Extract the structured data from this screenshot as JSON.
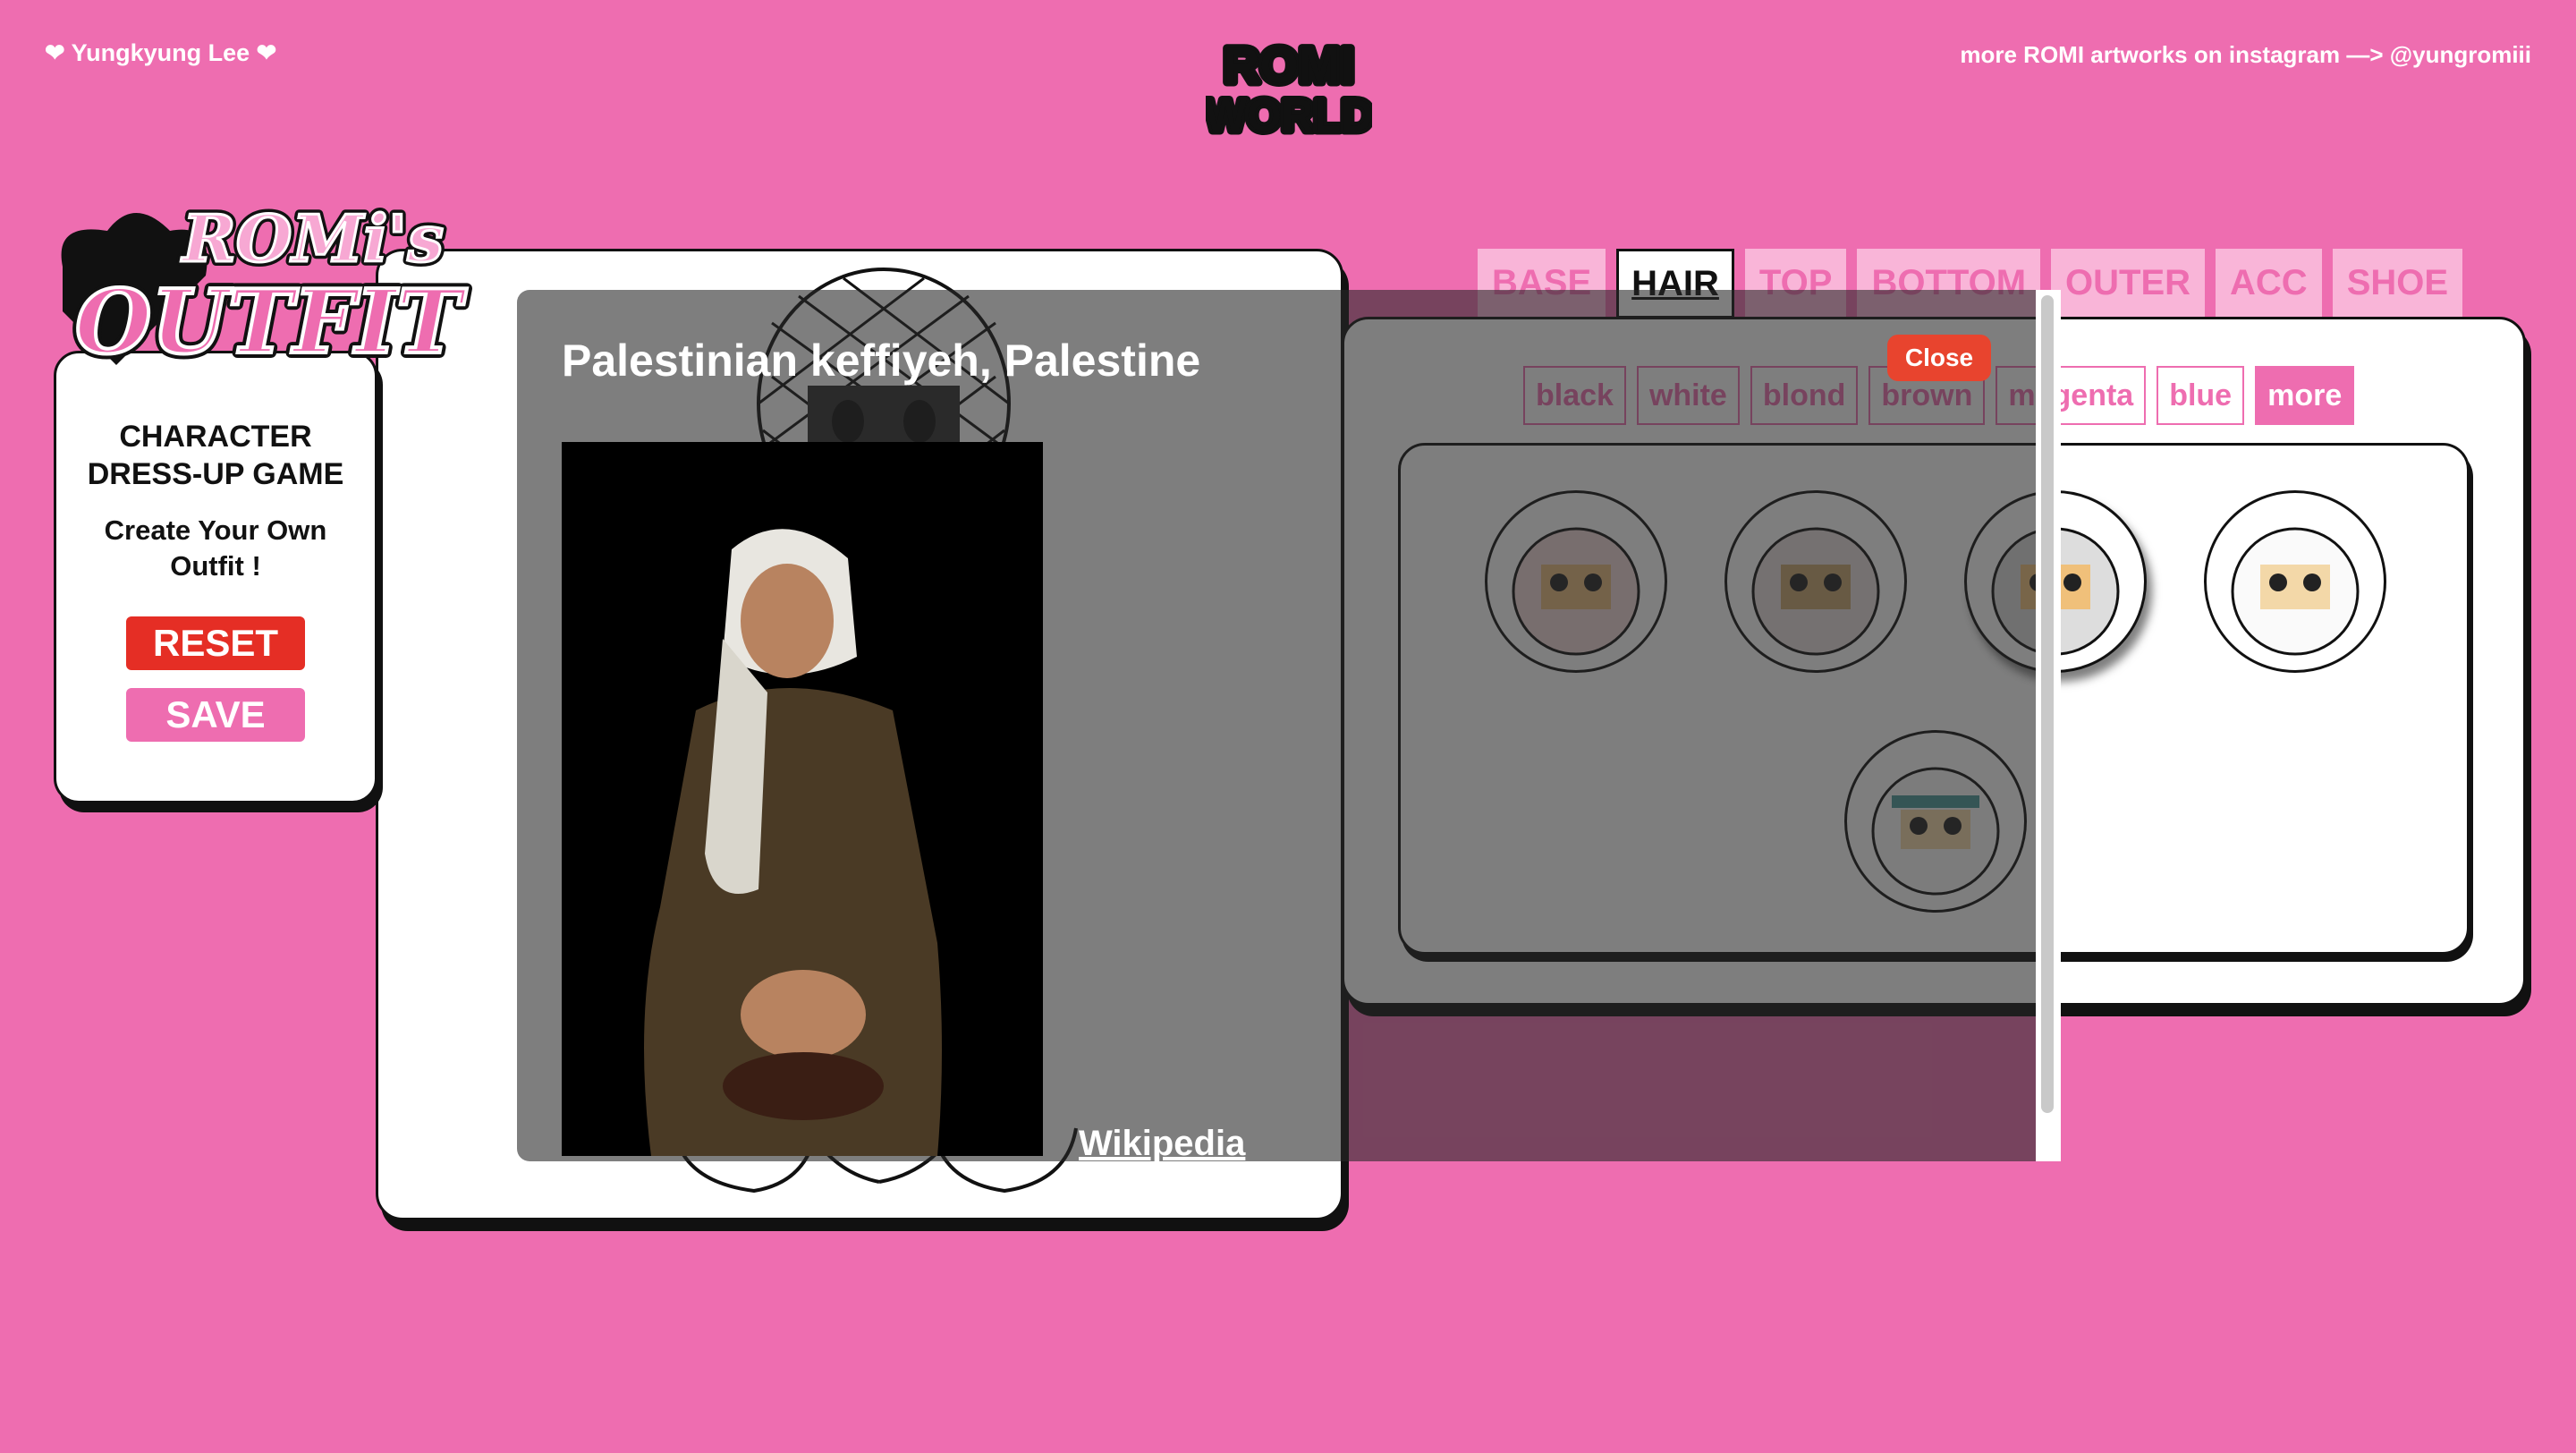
{
  "header": {
    "left_text": "❤ Yungkyung Lee ❤",
    "logo_line1": "ROMI",
    "logo_line2": "WORLD",
    "right_text": "more ROMI artworks on instagram —> @yungromiii"
  },
  "outfit_logo": {
    "line1": "ROMi's",
    "line2": "OUTFIT"
  },
  "side": {
    "title_line1": "CHARACTER",
    "title_line2": "DRESS-UP GAME",
    "subtitle_line1": "Create Your Own",
    "subtitle_line2": "Outfit !",
    "reset_label": "RESET",
    "save_label": "SAVE"
  },
  "tabs": [
    "BASE",
    "HAIR",
    "TOP",
    "BOTTOM",
    "OUTER",
    "ACC",
    "SHOE"
  ],
  "active_tab": "HAIR",
  "colors": [
    "black",
    "white",
    "blond",
    "brown",
    "magenta",
    "blue",
    "more"
  ],
  "active_color": "more",
  "modal": {
    "title": "Palestinian keffiyeh, Palestine",
    "link_label": "Wikipedia",
    "close_label": "Close"
  },
  "theme": {
    "pink": "#ee6db0",
    "red": "#e52e25",
    "dark": "#111111"
  }
}
